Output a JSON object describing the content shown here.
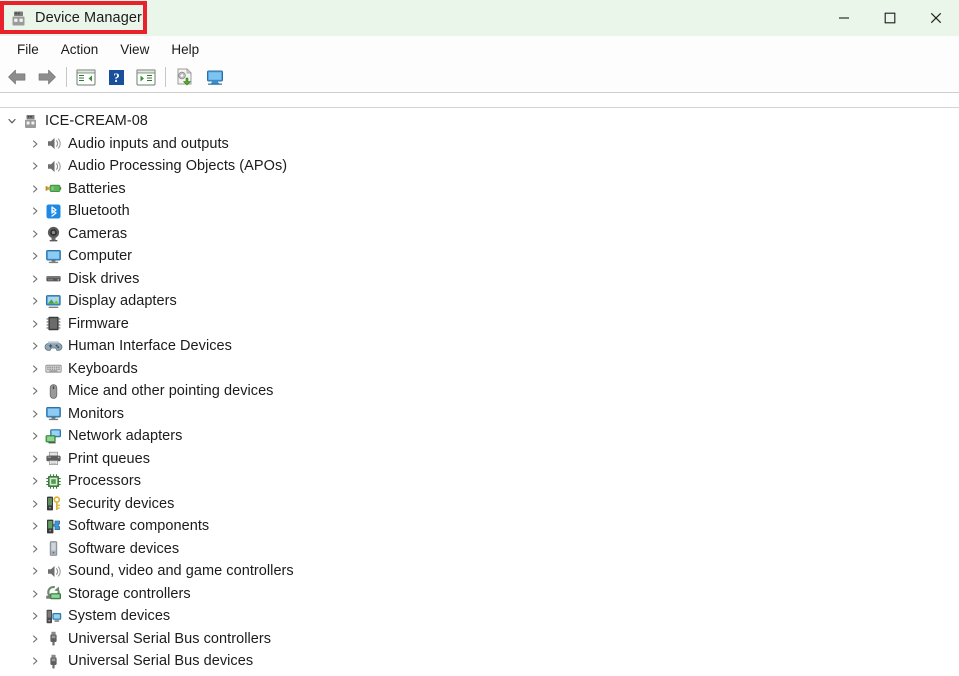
{
  "window": {
    "title": "Device Manager",
    "app_icon": "device-manager-icon",
    "highlight_color": "#e8212a",
    "titlebar_color": "#eaf6ea",
    "controls": [
      {
        "name": "minimize",
        "glyph": "minimize-icon"
      },
      {
        "name": "maximize",
        "glyph": "maximize-icon"
      },
      {
        "name": "close",
        "glyph": "close-icon"
      }
    ]
  },
  "menubar": {
    "items": [
      {
        "label": "File"
      },
      {
        "label": "Action"
      },
      {
        "label": "View"
      },
      {
        "label": "Help"
      }
    ]
  },
  "toolbar": {
    "buttons": [
      {
        "name": "back-button",
        "icon": "back-arrow-icon",
        "title": "Back"
      },
      {
        "name": "forward-button",
        "icon": "forward-arrow-icon",
        "title": "Forward"
      },
      {
        "name": "separator-1",
        "icon": "separator"
      },
      {
        "name": "show-hide-console-tree-button",
        "icon": "console-tree-icon",
        "title": "Show/Hide Console Tree"
      },
      {
        "name": "help-button",
        "icon": "help-question-icon",
        "title": "Help"
      },
      {
        "name": "properties-button",
        "icon": "properties-panel-icon",
        "title": "Properties"
      },
      {
        "name": "separator-2",
        "icon": "separator"
      },
      {
        "name": "update-driver-button",
        "icon": "update-driver-icon",
        "title": "Update Driver Software"
      },
      {
        "name": "scan-hardware-changes-button",
        "icon": "scan-hardware-icon",
        "title": "Scan for hardware changes"
      }
    ]
  },
  "tree": {
    "root": {
      "label": "ICE-CREAM-08",
      "icon": "computer-tower-icon",
      "expanded": true,
      "chevron": "chevron-down-icon"
    },
    "items": [
      {
        "label": "Audio inputs and outputs",
        "icon": "speaker-icon",
        "chevron": "chevron-right-icon"
      },
      {
        "label": "Audio Processing Objects (APOs)",
        "icon": "speaker-icon",
        "chevron": "chevron-right-icon"
      },
      {
        "label": "Batteries",
        "icon": "battery-icon",
        "chevron": "chevron-right-icon"
      },
      {
        "label": "Bluetooth",
        "icon": "bluetooth-icon",
        "chevron": "chevron-right-icon"
      },
      {
        "label": "Cameras",
        "icon": "camera-icon",
        "chevron": "chevron-right-icon"
      },
      {
        "label": "Computer",
        "icon": "monitor-icon",
        "chevron": "chevron-right-icon"
      },
      {
        "label": "Disk drives",
        "icon": "disk-drive-icon",
        "chevron": "chevron-right-icon"
      },
      {
        "label": "Display adapters",
        "icon": "display-adapter-icon",
        "chevron": "chevron-right-icon"
      },
      {
        "label": "Firmware",
        "icon": "firmware-chip-icon",
        "chevron": "chevron-right-icon"
      },
      {
        "label": "Human Interface Devices",
        "icon": "gamepad-icon",
        "chevron": "chevron-right-icon"
      },
      {
        "label": "Keyboards",
        "icon": "keyboard-icon",
        "chevron": "chevron-right-icon"
      },
      {
        "label": "Mice and other pointing devices",
        "icon": "mouse-icon",
        "chevron": "chevron-right-icon"
      },
      {
        "label": "Monitors",
        "icon": "monitor-icon",
        "chevron": "chevron-right-icon"
      },
      {
        "label": "Network adapters",
        "icon": "network-adapter-icon",
        "chevron": "chevron-right-icon"
      },
      {
        "label": "Print queues",
        "icon": "printer-icon",
        "chevron": "chevron-right-icon"
      },
      {
        "label": "Processors",
        "icon": "processor-chip-icon",
        "chevron": "chevron-right-icon"
      },
      {
        "label": "Security devices",
        "icon": "security-key-icon",
        "chevron": "chevron-right-icon"
      },
      {
        "label": "Software components",
        "icon": "software-component-icon",
        "chevron": "chevron-right-icon"
      },
      {
        "label": "Software devices",
        "icon": "software-device-icon",
        "chevron": "chevron-right-icon"
      },
      {
        "label": "Sound, video and game controllers",
        "icon": "speaker-icon",
        "chevron": "chevron-right-icon"
      },
      {
        "label": "Storage controllers",
        "icon": "storage-controller-icon",
        "chevron": "chevron-right-icon"
      },
      {
        "label": "System devices",
        "icon": "system-device-icon",
        "chevron": "chevron-right-icon"
      },
      {
        "label": "Universal Serial Bus controllers",
        "icon": "usb-icon",
        "chevron": "chevron-right-icon"
      },
      {
        "label": "Universal Serial Bus devices",
        "icon": "usb-icon",
        "chevron": "chevron-right-icon"
      }
    ]
  }
}
